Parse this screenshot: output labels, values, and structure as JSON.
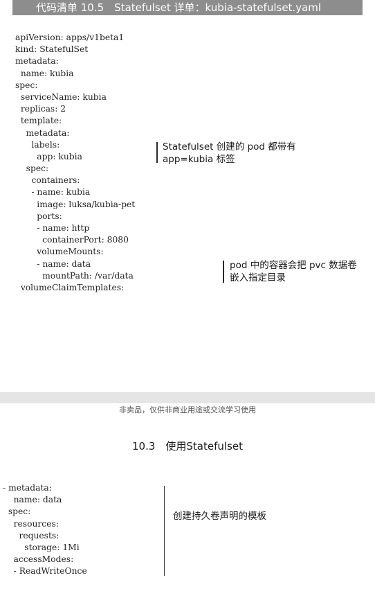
{
  "listing": {
    "title": "代码清单 10.5　Statefulset 详单：kubia-statefulset.yaml",
    "code_lines": [
      "apiVersion: apps/v1beta1",
      "kind: StatefulSet",
      "metadata:",
      "  name: kubia",
      "spec:",
      "  serviceName: kubia",
      "  replicas: 2",
      "  template:",
      "    metadata:",
      "      labels:",
      "        app: kubia",
      "    spec:",
      "      containers:",
      "      - name: kubia",
      "        image: luksa/kubia-pet",
      "        ports:",
      "        - name: http",
      "          containerPort: 8080",
      "        volumeMounts:",
      "        - name: data",
      "          mountPath: /var/data",
      "  volumeClaimTemplates:"
    ],
    "annotation_labels": {
      "line1": "Statefulset 创建的 pod 都带有",
      "line2": "app=kubia 标签"
    },
    "annotation_volume": {
      "line1": "pod 中的容器会把 pvc 数据卷",
      "line2": "嵌入指定目录"
    }
  },
  "watermark": "非卖品，仅供非商业用途或交流学习使用",
  "section_heading": "10.3　使用Statefulset",
  "continuation": {
    "code_lines": [
      "- metadata:",
      "    name: data",
      "  spec:",
      "    resources:",
      "      requests:",
      "        storage: 1Mi",
      "    accessModes:",
      "    - ReadWriteOnce"
    ],
    "annotation_template": "创建持久卷声明的模板"
  }
}
